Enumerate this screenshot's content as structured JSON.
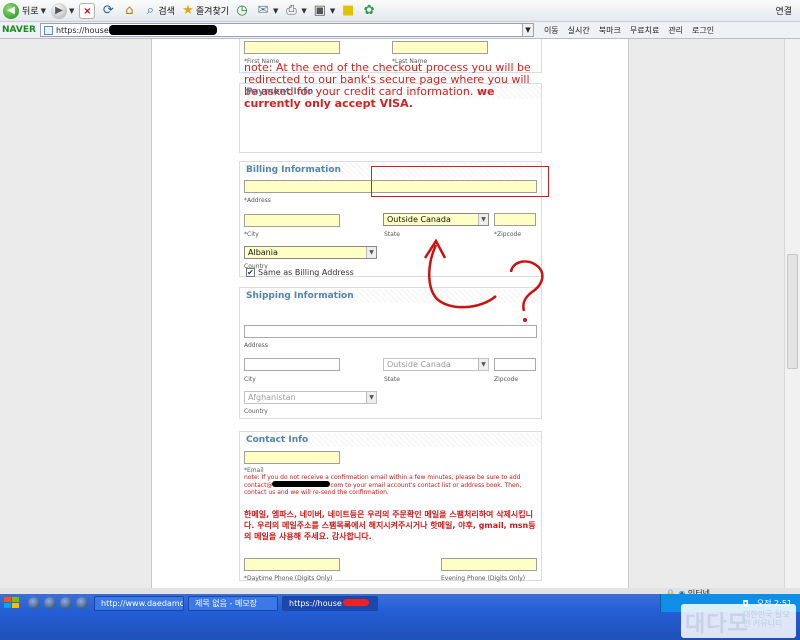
{
  "toolbar": {
    "back": "뒤로",
    "search": "검색",
    "favorites": "즐겨찾기",
    "connect": "연결"
  },
  "address": {
    "brand": "NAVER",
    "url": "https://house",
    "links": [
      "이동",
      "실시간",
      "북마크",
      "무료치료",
      "관리",
      "로그인"
    ]
  },
  "form": {
    "first_name": "*First Name",
    "last_name": "*Last Name",
    "payment_title": "Payment Info",
    "payment_note": "note: At the end of the checkout process you will be redirected to our bank's secure page where you will be asked for your credit card information.",
    "payment_note_bold": "we currently only accept VISA.",
    "billing_title": "Billing Information",
    "billing_address": "*Address",
    "billing_city": "*City",
    "billing_state_value": "Outside Canada",
    "billing_state": "State",
    "billing_zip": "*Zipcode",
    "billing_country_value": "Albania",
    "billing_country": "Country",
    "shipping_title": "Shipping Information",
    "same_as_billing": "Same as Billing Address",
    "ship_address": "Address",
    "ship_city": "City",
    "ship_state_value": "Outside Canada",
    "ship_state": "State",
    "ship_zip": "Zipcode",
    "ship_country_value": "Afghanistan",
    "ship_country": "Country",
    "contact_title": "Contact Info",
    "email": "*Email",
    "email_note_a": "note: If you do not receive a confirmation email within a few minutes, please be sure to add contact@",
    "email_note_b": "com to your email account's contact list or address book. Then, contact us and we will re-send the confirmation.",
    "korean_note": "한메일, 엠파스, 네이버, 네이트등은 우리의 주문확인 메일을 스팸처리하여 삭제시킵니다. 우리의 메일주소를 스팸목록에서 해지시켜주시거나 핫메일, 야후, gmail, msn등의 메일을 사용해 주세요. 감사합니다.",
    "daytime_phone": "*Daytime Phone (Digits Only)",
    "evening_phone": "Evening Phone (Digits Only)"
  },
  "statusbar": {
    "zone": "인터넷"
  },
  "taskbar": {
    "tasks": [
      "http://www.daedamo....",
      "제목 없음 - 메모장",
      "https://house"
    ],
    "clock": "오전 2:51"
  },
  "watermark": {
    "big": "대다모",
    "small": "대한민국 탈모인 커뮤니티"
  },
  "colors": {
    "field_yellow": "#ffffc6",
    "section_title": "#5584ab",
    "note_red": "#d32020",
    "annotation_red": "#cc1111"
  }
}
